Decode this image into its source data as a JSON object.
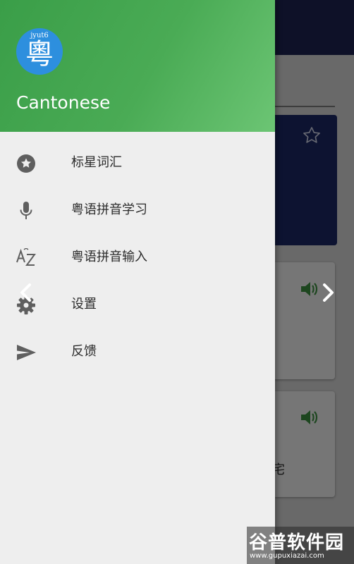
{
  "drawer": {
    "logo_top_text": "jyut6",
    "logo_char": "粵",
    "app_name": "Cantonese",
    "items": [
      {
        "label": "标星词汇",
        "icon": "star-circle-icon"
      },
      {
        "label": "粤语拼音学习",
        "icon": "microphone-icon"
      },
      {
        "label": "粤语拼音输入",
        "icon": "az-sort-icon"
      },
      {
        "label": "设置",
        "icon": "gear-icon"
      },
      {
        "label": "反馈",
        "icon": "send-icon"
      }
    ]
  },
  "background": {
    "partial_text": "宅"
  },
  "watermark": {
    "main": "谷普软件园",
    "sub": "www.gupuxiazai.com"
  },
  "colors": {
    "header_green": "#4aab55",
    "logo_blue": "#2d8fde",
    "appbar_navy": "#1c2350",
    "speaker_green": "#3a8c3f",
    "icon_gray": "#5f5f5f"
  }
}
